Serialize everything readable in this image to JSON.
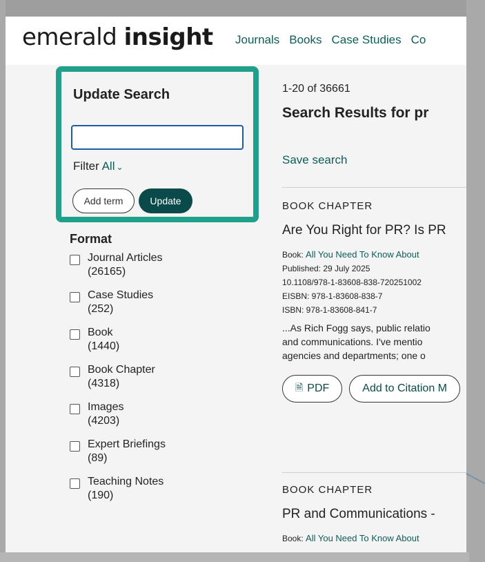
{
  "logo": {
    "light": "emerald ",
    "bold": "insight"
  },
  "nav": [
    "Journals",
    "Books",
    "Case Studies",
    "Co"
  ],
  "update_search": {
    "title": "Update Search",
    "input_value": "",
    "filter_label": "Filter",
    "filter_value": "All",
    "add_term": "Add term",
    "update": "Update"
  },
  "format": {
    "title": "Format",
    "items": [
      {
        "label": "Journal Articles",
        "count": "(26165)"
      },
      {
        "label": "Case Studies",
        "count": "(252)"
      },
      {
        "label": "Book",
        "count": "(1440)"
      },
      {
        "label": "Book Chapter",
        "count": "(4318)"
      },
      {
        "label": "Images",
        "count": "(4203)"
      },
      {
        "label": "Expert Briefings",
        "count": "(89)"
      },
      {
        "label": "Teaching Notes",
        "count": "(190)"
      }
    ]
  },
  "results": {
    "count": "1-20 of 36661",
    "title": "Search Results for pr",
    "save_search": "Save search",
    "items": [
      {
        "type": "BOOK CHAPTER",
        "title": "Are You Right for PR? Is PR",
        "book_label": "Book: ",
        "book_link": "All You Need To Know About",
        "published": "Published: 29 July 2025",
        "doi": "10.1108/978-1-83608-838-720251002",
        "eisbn": "EISBN: 978-1-83608-838-7",
        "isbn": "ISBN: 978-1-83608-841-7",
        "excerpt": [
          "...As Rich Fogg says, public relatio",
          "and communications. I've mentio",
          "agencies and departments; one o"
        ],
        "pdf": "PDF",
        "cite": "Add to Citation M"
      },
      {
        "type": "BOOK CHAPTER",
        "title": "PR and Communications -",
        "book_label": "Book: ",
        "book_link": "All You Need To Know About"
      }
    ]
  }
}
